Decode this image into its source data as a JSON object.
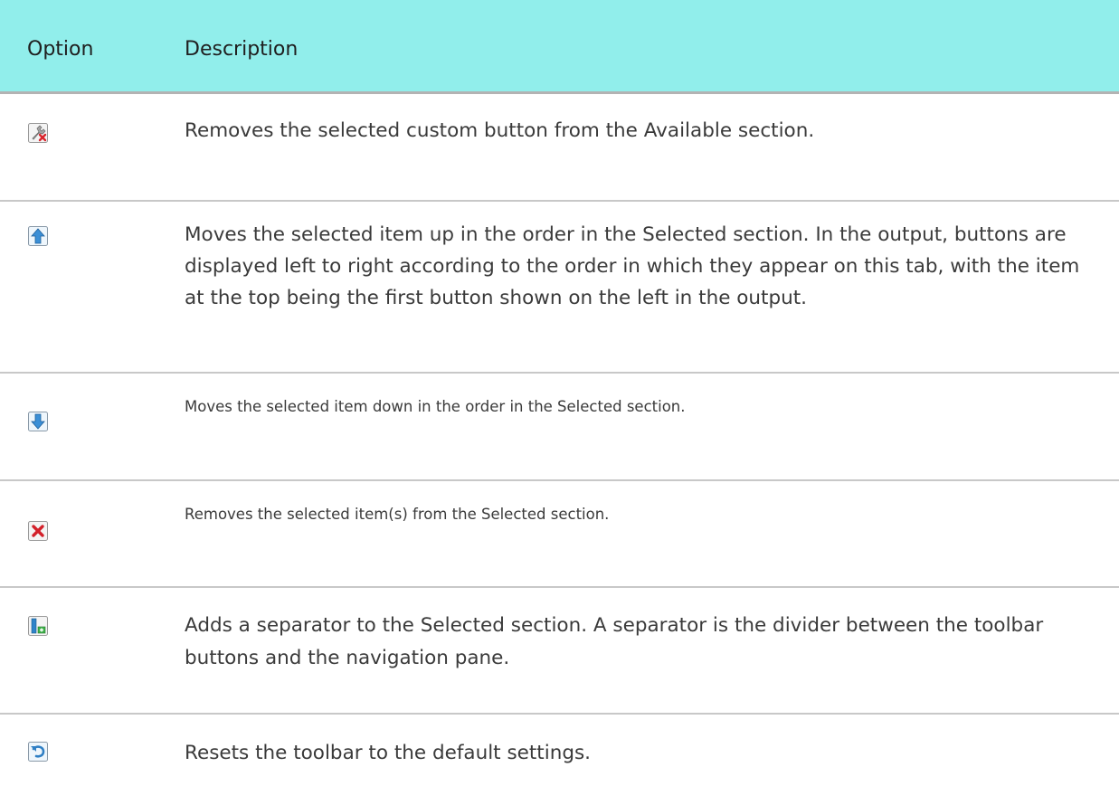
{
  "header": {
    "option": "Option",
    "description": "Description"
  },
  "rows": [
    {
      "icon": "remove-custom-button-icon",
      "description": "Removes the selected custom button from the Available section."
    },
    {
      "icon": "move-up-icon",
      "description": "Moves the selected item up in the order in the Selected section. In the output, buttons are displayed left to right according to the order in which they appear on this tab, with the item at the top being the first button shown on the left in the output."
    },
    {
      "icon": "move-down-icon",
      "description": "Moves the selected item down in the order in the Selected section."
    },
    {
      "icon": "remove-item-icon",
      "description": "Removes the selected item(s) from the Selected section."
    },
    {
      "icon": "add-separator-icon",
      "description": "Adds a separator to the Selected section. A separator is the divider between the toolbar buttons and the navigation pane."
    },
    {
      "icon": "reset-icon",
      "description": "Resets the toolbar to the default settings."
    }
  ],
  "colors": {
    "header_background": "#91eeeb",
    "row_divider": "#c8c8c8"
  }
}
